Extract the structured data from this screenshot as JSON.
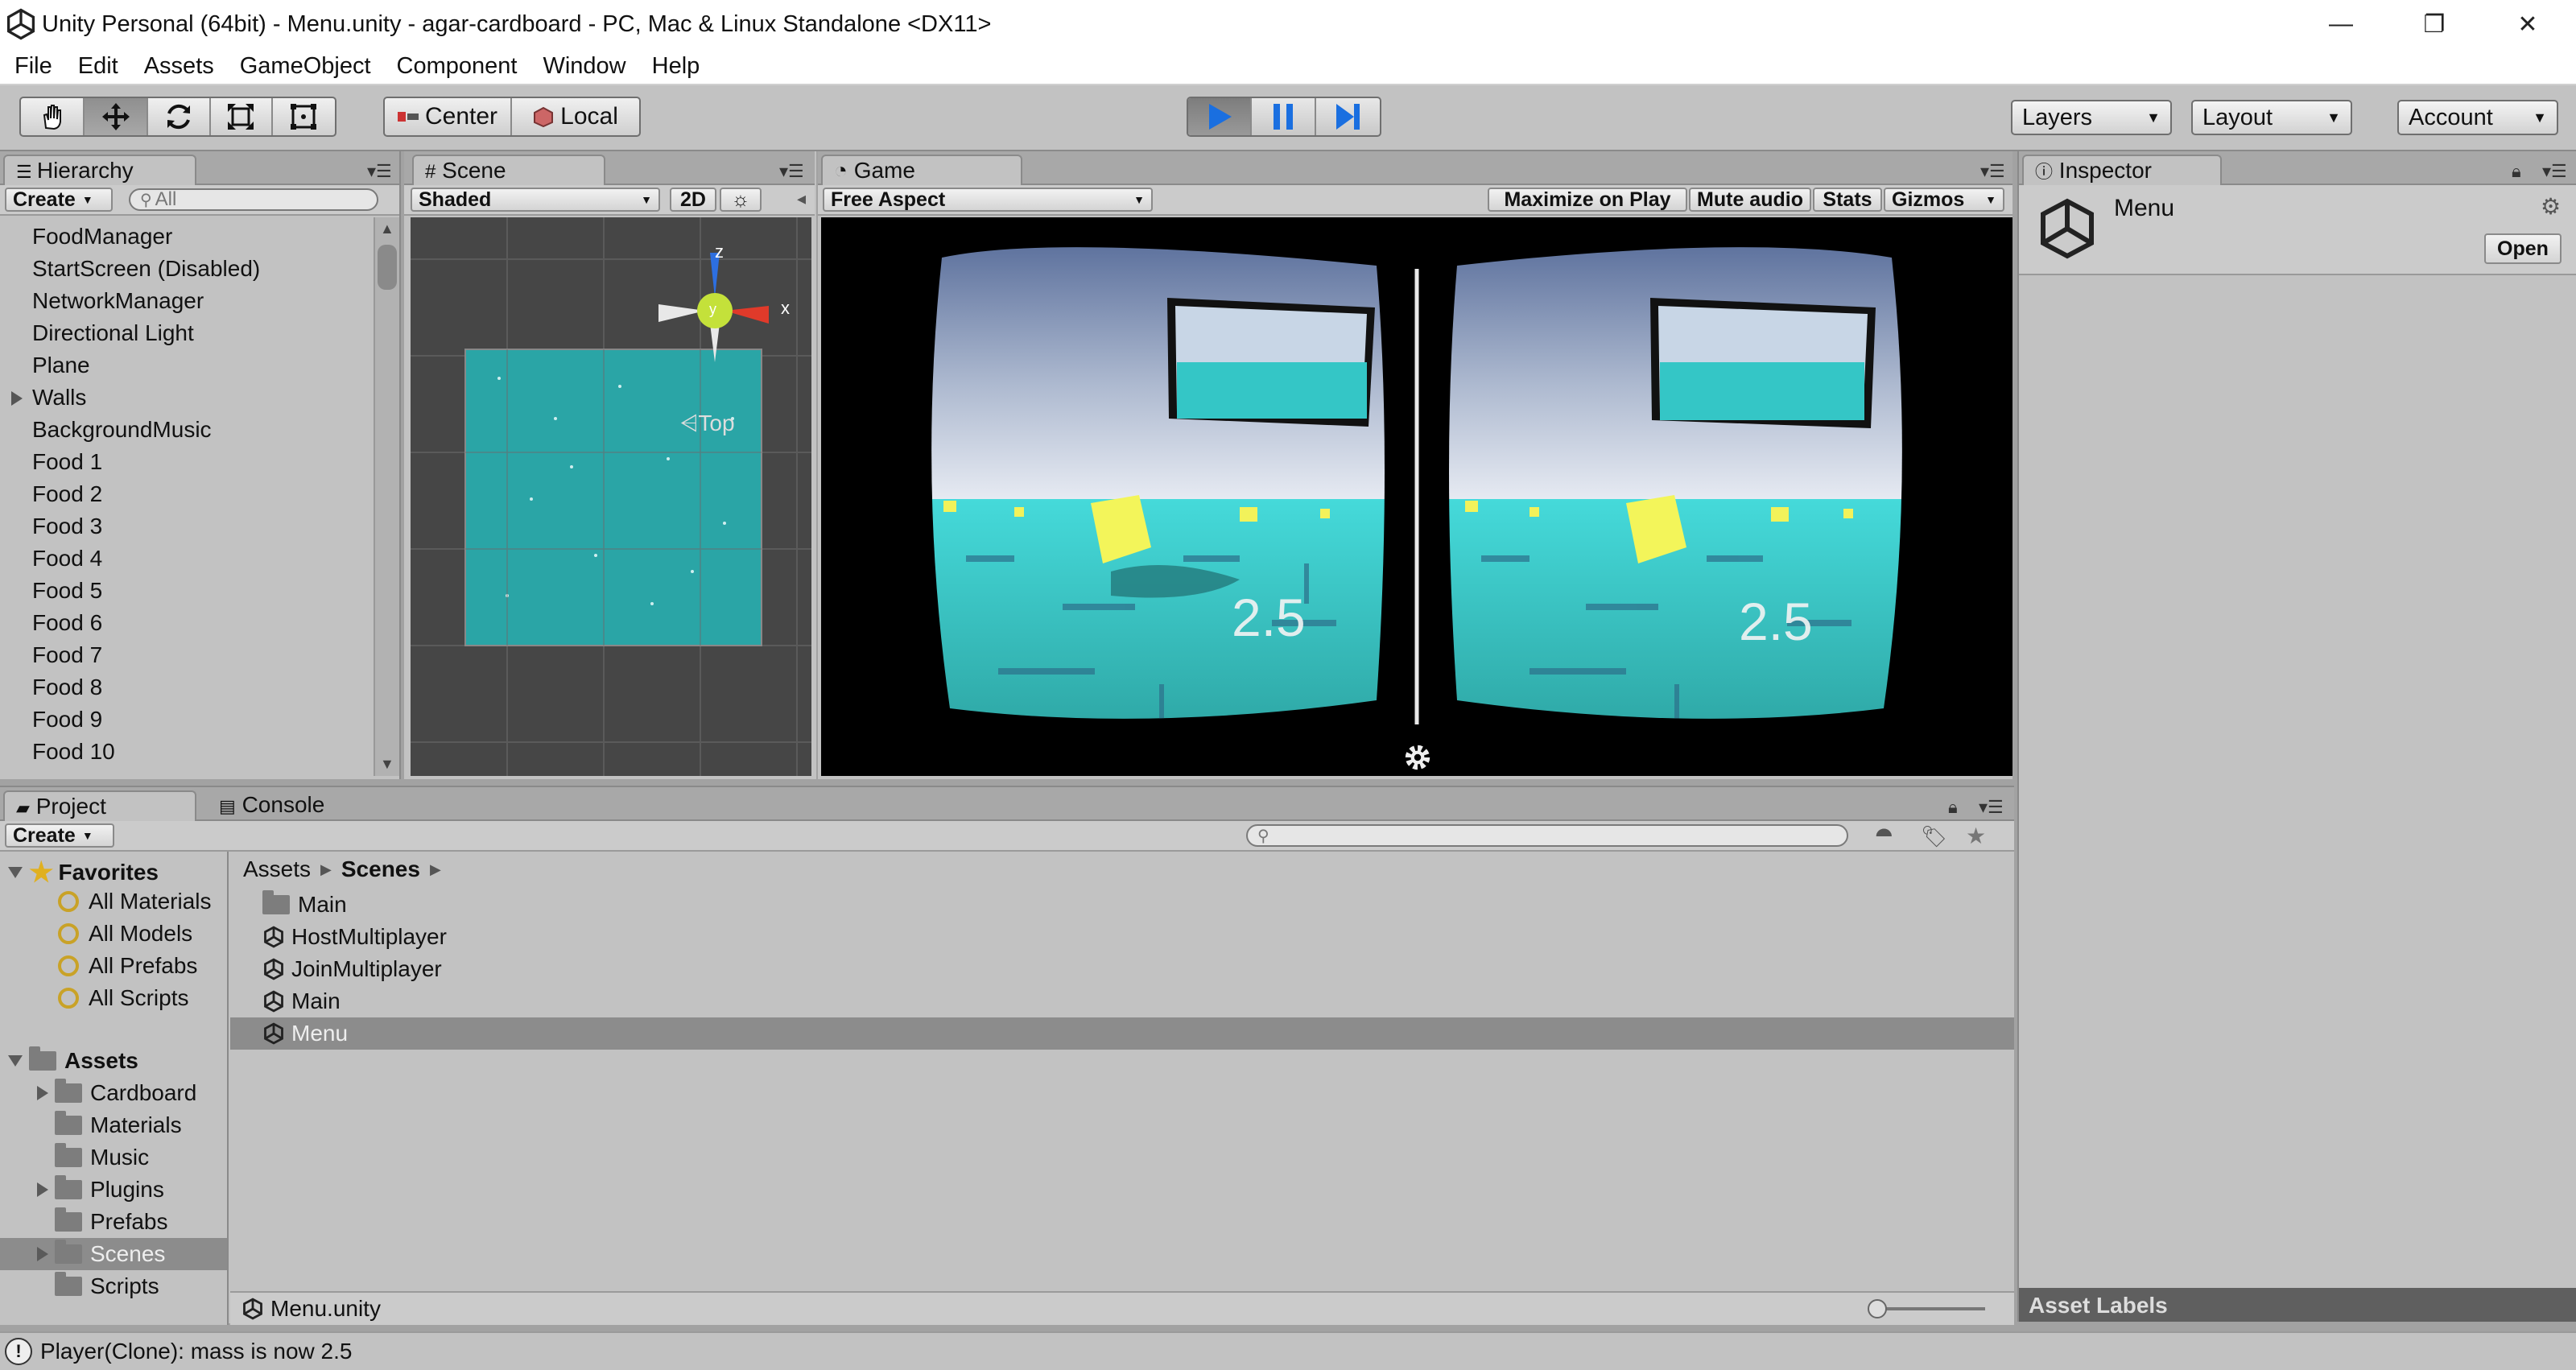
{
  "window": {
    "title": "Unity Personal (64bit) - Menu.unity - agar-cardboard - PC, Mac & Linux Standalone <DX11>",
    "minimize": "—",
    "restore": "❐",
    "close": "✕"
  },
  "menu": [
    "File",
    "Edit",
    "Assets",
    "GameObject",
    "Component",
    "Window",
    "Help"
  ],
  "toolbar": {
    "pivot_center": "Center",
    "pivot_local": "Local",
    "layers": "Layers",
    "layout": "Layout",
    "account": "Account"
  },
  "hierarchy": {
    "tab": "Hierarchy",
    "create": "Create",
    "search_placeholder": "All",
    "items": [
      "FoodManager",
      "StartScreen (Disabled)",
      "NetworkManager",
      "Directional Light",
      "Plane",
      "Walls",
      "BackgroundMusic",
      "Food 1",
      "Food 2",
      "Food 3",
      "Food 4",
      "Food 5",
      "Food 6",
      "Food 7",
      "Food 8",
      "Food 9",
      "Food 10"
    ]
  },
  "scene": {
    "tab": "Scene",
    "shading": "Shaded",
    "mode2d": "2D",
    "gizmo_label": "Top",
    "axis_z": "z",
    "axis_x": "x",
    "axis_y": "y"
  },
  "game": {
    "tab": "Game",
    "aspect": "Free Aspect",
    "maximize": "Maximize on Play",
    "mute": "Mute audio",
    "stats": "Stats",
    "gizmos": "Gizmos",
    "score_left": "2.5",
    "score_right": "2.5"
  },
  "inspector": {
    "tab": "Inspector",
    "asset_name": "Menu",
    "open": "Open",
    "asset_labels": "Asset Labels"
  },
  "project": {
    "tab": "Project",
    "console_tab": "Console",
    "create": "Create",
    "favorites_title": "Favorites",
    "favorites": [
      "All Materials",
      "All Models",
      "All Prefabs",
      "All Scripts"
    ],
    "assets_title": "Assets",
    "folders": [
      "Cardboard",
      "Materials",
      "Music",
      "Plugins",
      "Prefabs",
      "Scenes",
      "Scripts"
    ],
    "breadcrumb": [
      "Assets",
      "Scenes"
    ],
    "files": [
      "Main",
      "HostMultiplayer",
      "JoinMultiplayer",
      "Main",
      "Menu"
    ],
    "selected_path": "Menu.unity"
  },
  "status": {
    "message": "Player(Clone): mass is now 2.5"
  }
}
